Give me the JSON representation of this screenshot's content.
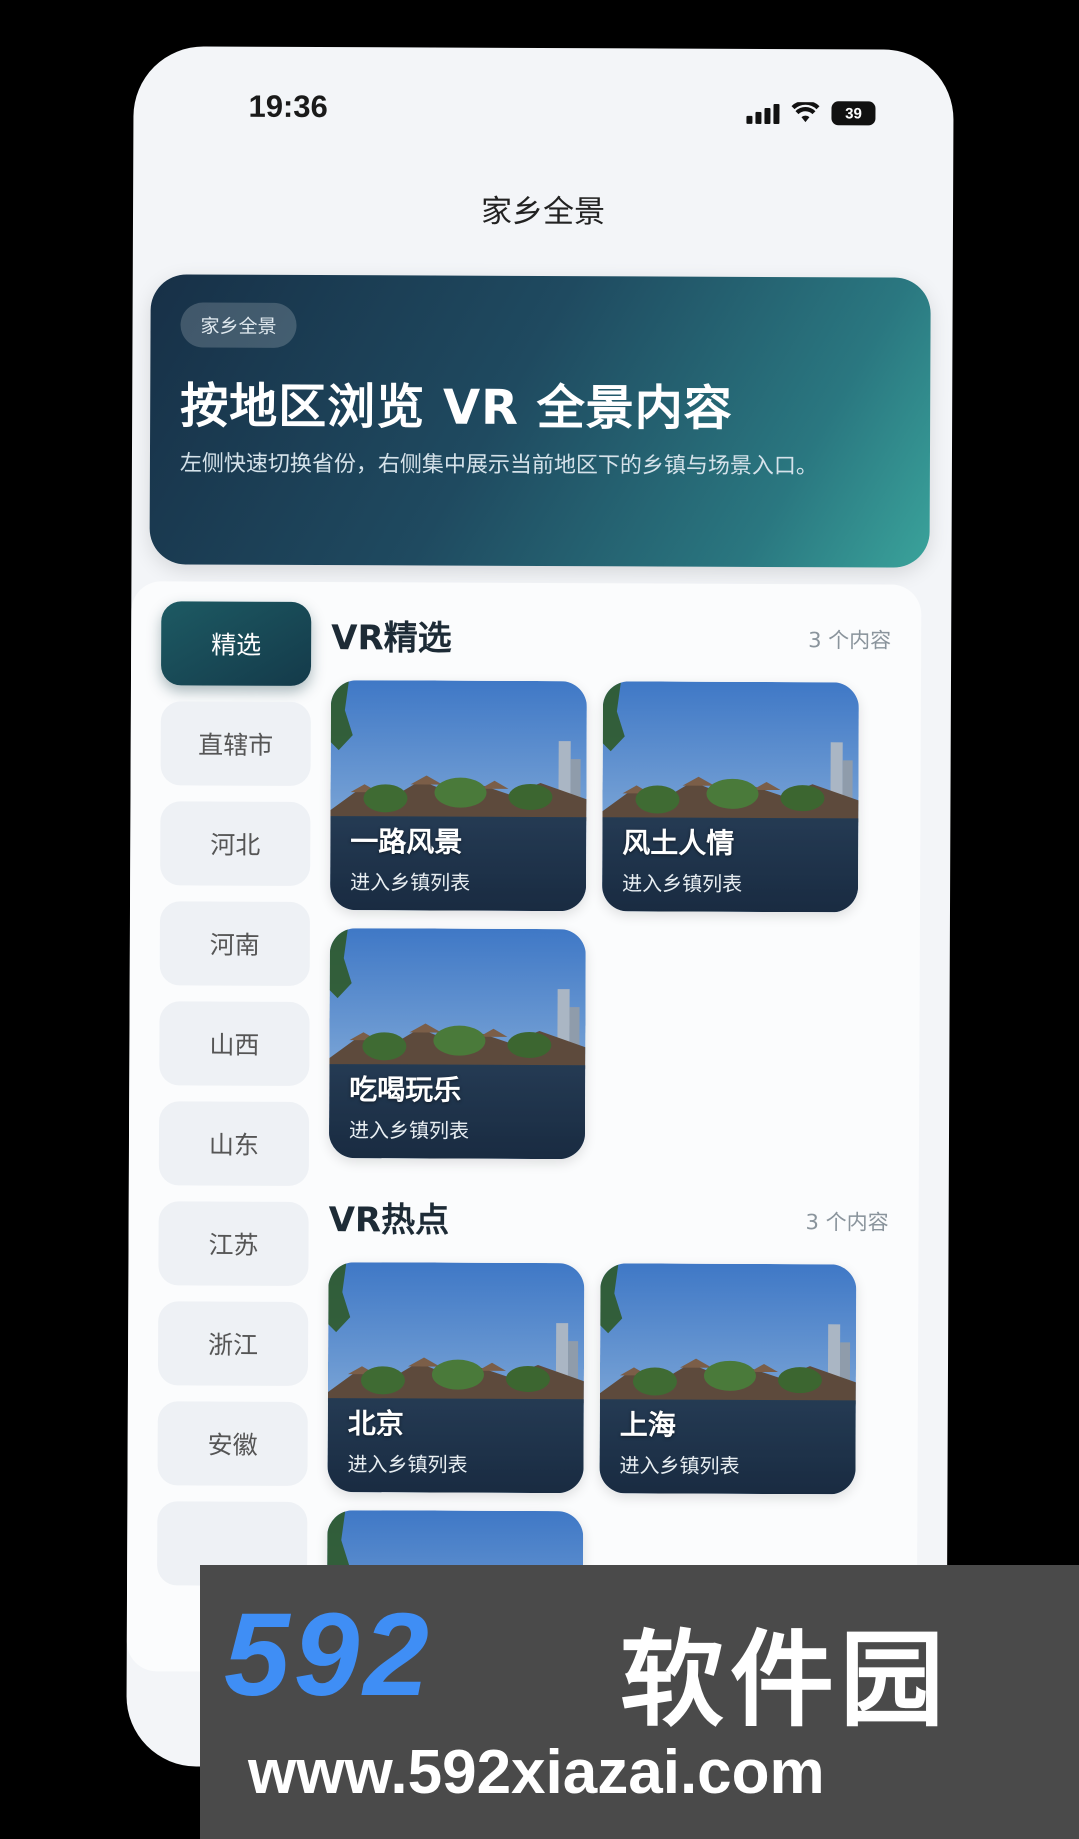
{
  "status_bar": {
    "time": "19:36",
    "battery": "39"
  },
  "nav": {
    "title": "家乡全景"
  },
  "hero": {
    "tag": "家乡全景",
    "title": "按地区浏览 VR 全景内容",
    "description": "左侧快速切换省份，右侧集中展示当前地区下的乡镇与场景入口。"
  },
  "regions": [
    "精选",
    "直辖市",
    "河北",
    "河南",
    "山西",
    "山东",
    "江苏",
    "浙江",
    "安徽"
  ],
  "active_region": "精选",
  "sections": [
    {
      "title": "VR精选",
      "count": "3 个内容",
      "cards": [
        {
          "name": "一路风景",
          "sub": "进入乡镇列表"
        },
        {
          "name": "风土人情",
          "sub": "进入乡镇列表"
        },
        {
          "name": "吃喝玩乐",
          "sub": "进入乡镇列表"
        }
      ]
    },
    {
      "title": "VR热点",
      "count": "3 个内容",
      "cards": [
        {
          "name": "北京",
          "sub": "进入乡镇列表"
        },
        {
          "name": "上海",
          "sub": "进入乡镇列表"
        }
      ]
    }
  ],
  "watermark": {
    "logo": "592",
    "brand": "软件园",
    "url": "www.592xiazai.com"
  },
  "colors": {
    "accent": "#1d5a63",
    "hero_start": "#173047",
    "hero_end": "#3aa39b"
  }
}
